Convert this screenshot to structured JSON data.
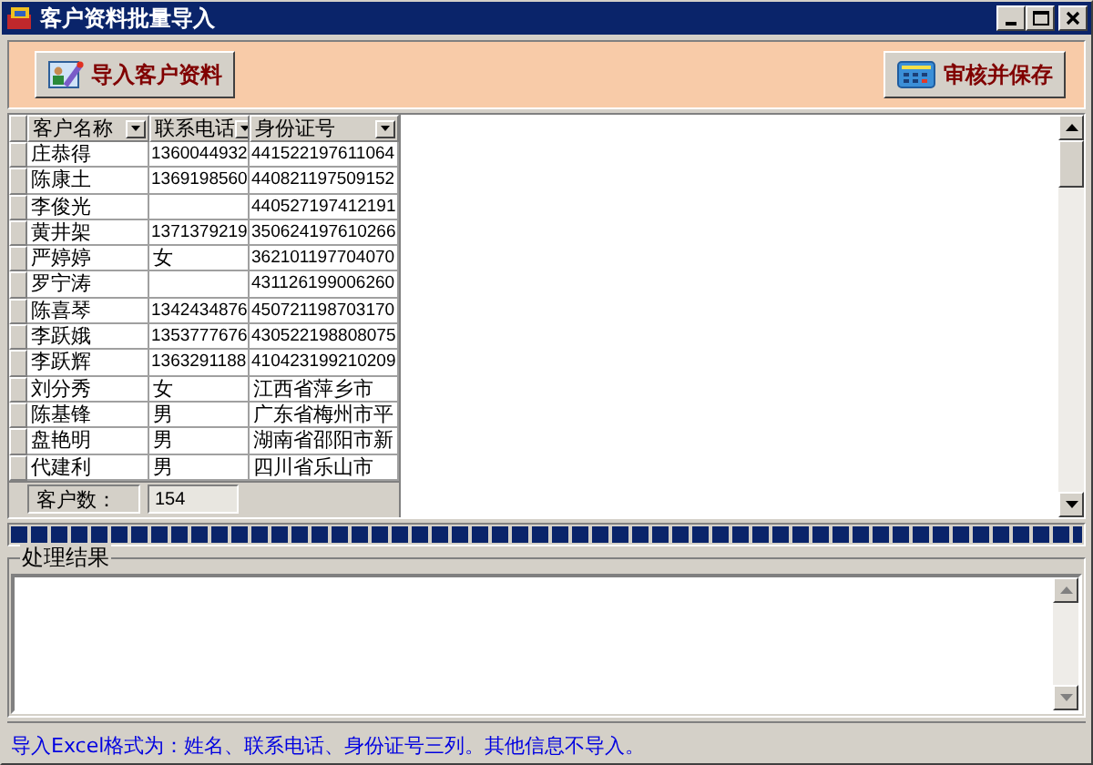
{
  "window": {
    "title": "客户资料批量导入"
  },
  "toolbar": {
    "buttons": [
      {
        "label": "导入客户资料",
        "kind": "import"
      },
      {
        "label": "审核并保存",
        "kind": "save"
      }
    ]
  },
  "grid": {
    "columns": [
      {
        "label": "客户名称"
      },
      {
        "label": "联系电话"
      },
      {
        "label": "身份证号"
      }
    ],
    "rows": [
      [
        "庄恭得",
        "1360044932",
        "441522197611064"
      ],
      [
        "陈康土",
        "1369198560",
        "440821197509152"
      ],
      [
        "李俊光",
        "",
        "440527197412191"
      ],
      [
        "黄井架",
        "1371379219",
        "350624197610266"
      ],
      [
        "严婷婷",
        "女",
        "362101197704070"
      ],
      [
        "罗宁涛",
        "",
        "431126199006260"
      ],
      [
        "陈喜琴",
        "1342434876",
        "450721198703170"
      ],
      [
        "李跃娥",
        "1353777676",
        "430522198808075"
      ],
      [
        "李跃辉",
        "1363291188",
        "410423199210209"
      ],
      [
        "刘分秀",
        "女",
        "江西省萍乡市"
      ],
      [
        "陈基锋",
        "男",
        "广东省梅州市平"
      ],
      [
        "盘艳明",
        "男",
        "湖南省邵阳市新"
      ],
      [
        "代建利",
        "男",
        "四川省乐山市"
      ]
    ],
    "footer": {
      "label": "客户数：",
      "value": "154"
    }
  },
  "progress": {
    "level": 1
  },
  "result": {
    "title": "处理结果"
  },
  "status_bar": {
    "text": "导入Excel格式为：姓名、联系电话、身份证号三列。其他信息不导入。"
  }
}
